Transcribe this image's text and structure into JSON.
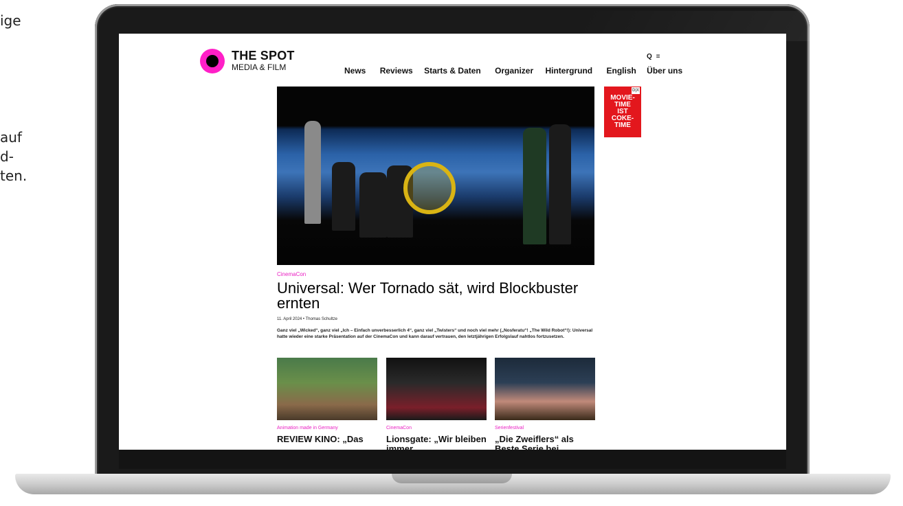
{
  "slide": {
    "fragments": [
      "ige",
      "auf",
      "d-",
      "ten."
    ]
  },
  "site": {
    "logo": {
      "title": "THE SPOT",
      "subtitle": "MEDIA & FILM"
    },
    "tools": {
      "search_icon": "Q",
      "menu_icon": "≡"
    },
    "nav": [
      "News",
      "Reviews",
      "Starts & Daten",
      "Organizer",
      "Hintergrund",
      "English",
      "Über uns"
    ],
    "ad": {
      "text": "MOVIE-\nTIME\nIST\nCOKE-\nTIME",
      "badge": "D|X"
    },
    "lead": {
      "kicker": "CinemaCon",
      "headline": "Universal: Wer Tornado sät, wird Blockbuster ernten",
      "meta": "11. April 2024 • Thomas Schultze",
      "lede": "Ganz viel „Wicked“, ganz viel „Ich – Einfach unverbesserlich 4“, ganz viel „Twisters“ und noch viel mehr („Nosferatu“! „The Wild Robot“!): Universal hatte wieder eine starke Präsentation auf der CinemaCon und kann darauf vertrauen, den letztjährigen Erfolgslauf nahtlos fortzusetzen."
    },
    "cards": [
      {
        "kicker": "Animation made in Germany",
        "title": "REVIEW KINO: „Das"
      },
      {
        "kicker": "CinemaCon",
        "title": "Lionsgate: „Wir bleiben immer"
      },
      {
        "kicker": "Serienfestival",
        "title": "„Die Zweiflers“ als Beste Serie bei"
      }
    ]
  },
  "colors": {
    "accent": "#e91ec2",
    "logo_ring": "#ff1fc7",
    "ad": "#e3171d"
  }
}
